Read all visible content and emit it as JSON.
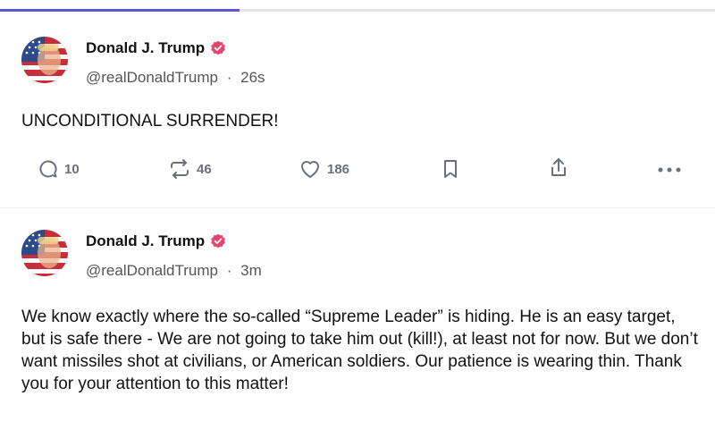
{
  "progress": {
    "value_fraction": 0.33,
    "fill_color": "#5b57d9",
    "track_color": "#e3e4ec"
  },
  "posts": [
    {
      "author_name": "Donald J. Trump",
      "handle": "@realDonaldTrump",
      "separator": "·",
      "time": "26s",
      "text": "UNCONDITIONAL SURRENDER!",
      "verified_icon": "verified-badge-icon",
      "actions": {
        "reply_count": "10",
        "repost_count": "46",
        "like_count": "186"
      }
    },
    {
      "author_name": "Donald J. Trump",
      "handle": "@realDonaldTrump",
      "separator": "·",
      "time": "3m",
      "text": "We know exactly where the so-called “Supreme Leader” is hiding. He is an easy target, but is safe there - We are not going to take him out (kill!), at least not for now. But we don’t want missiles shot at civilians, or American soldiers. Our patience is wearing thin. Thank you for your attention to this matter!",
      "verified_icon": "verified-badge-icon"
    }
  ],
  "colors": {
    "verified": "#e5446d",
    "icon_gray": "#6b6f80",
    "text": "#111111",
    "muted": "#555555"
  }
}
